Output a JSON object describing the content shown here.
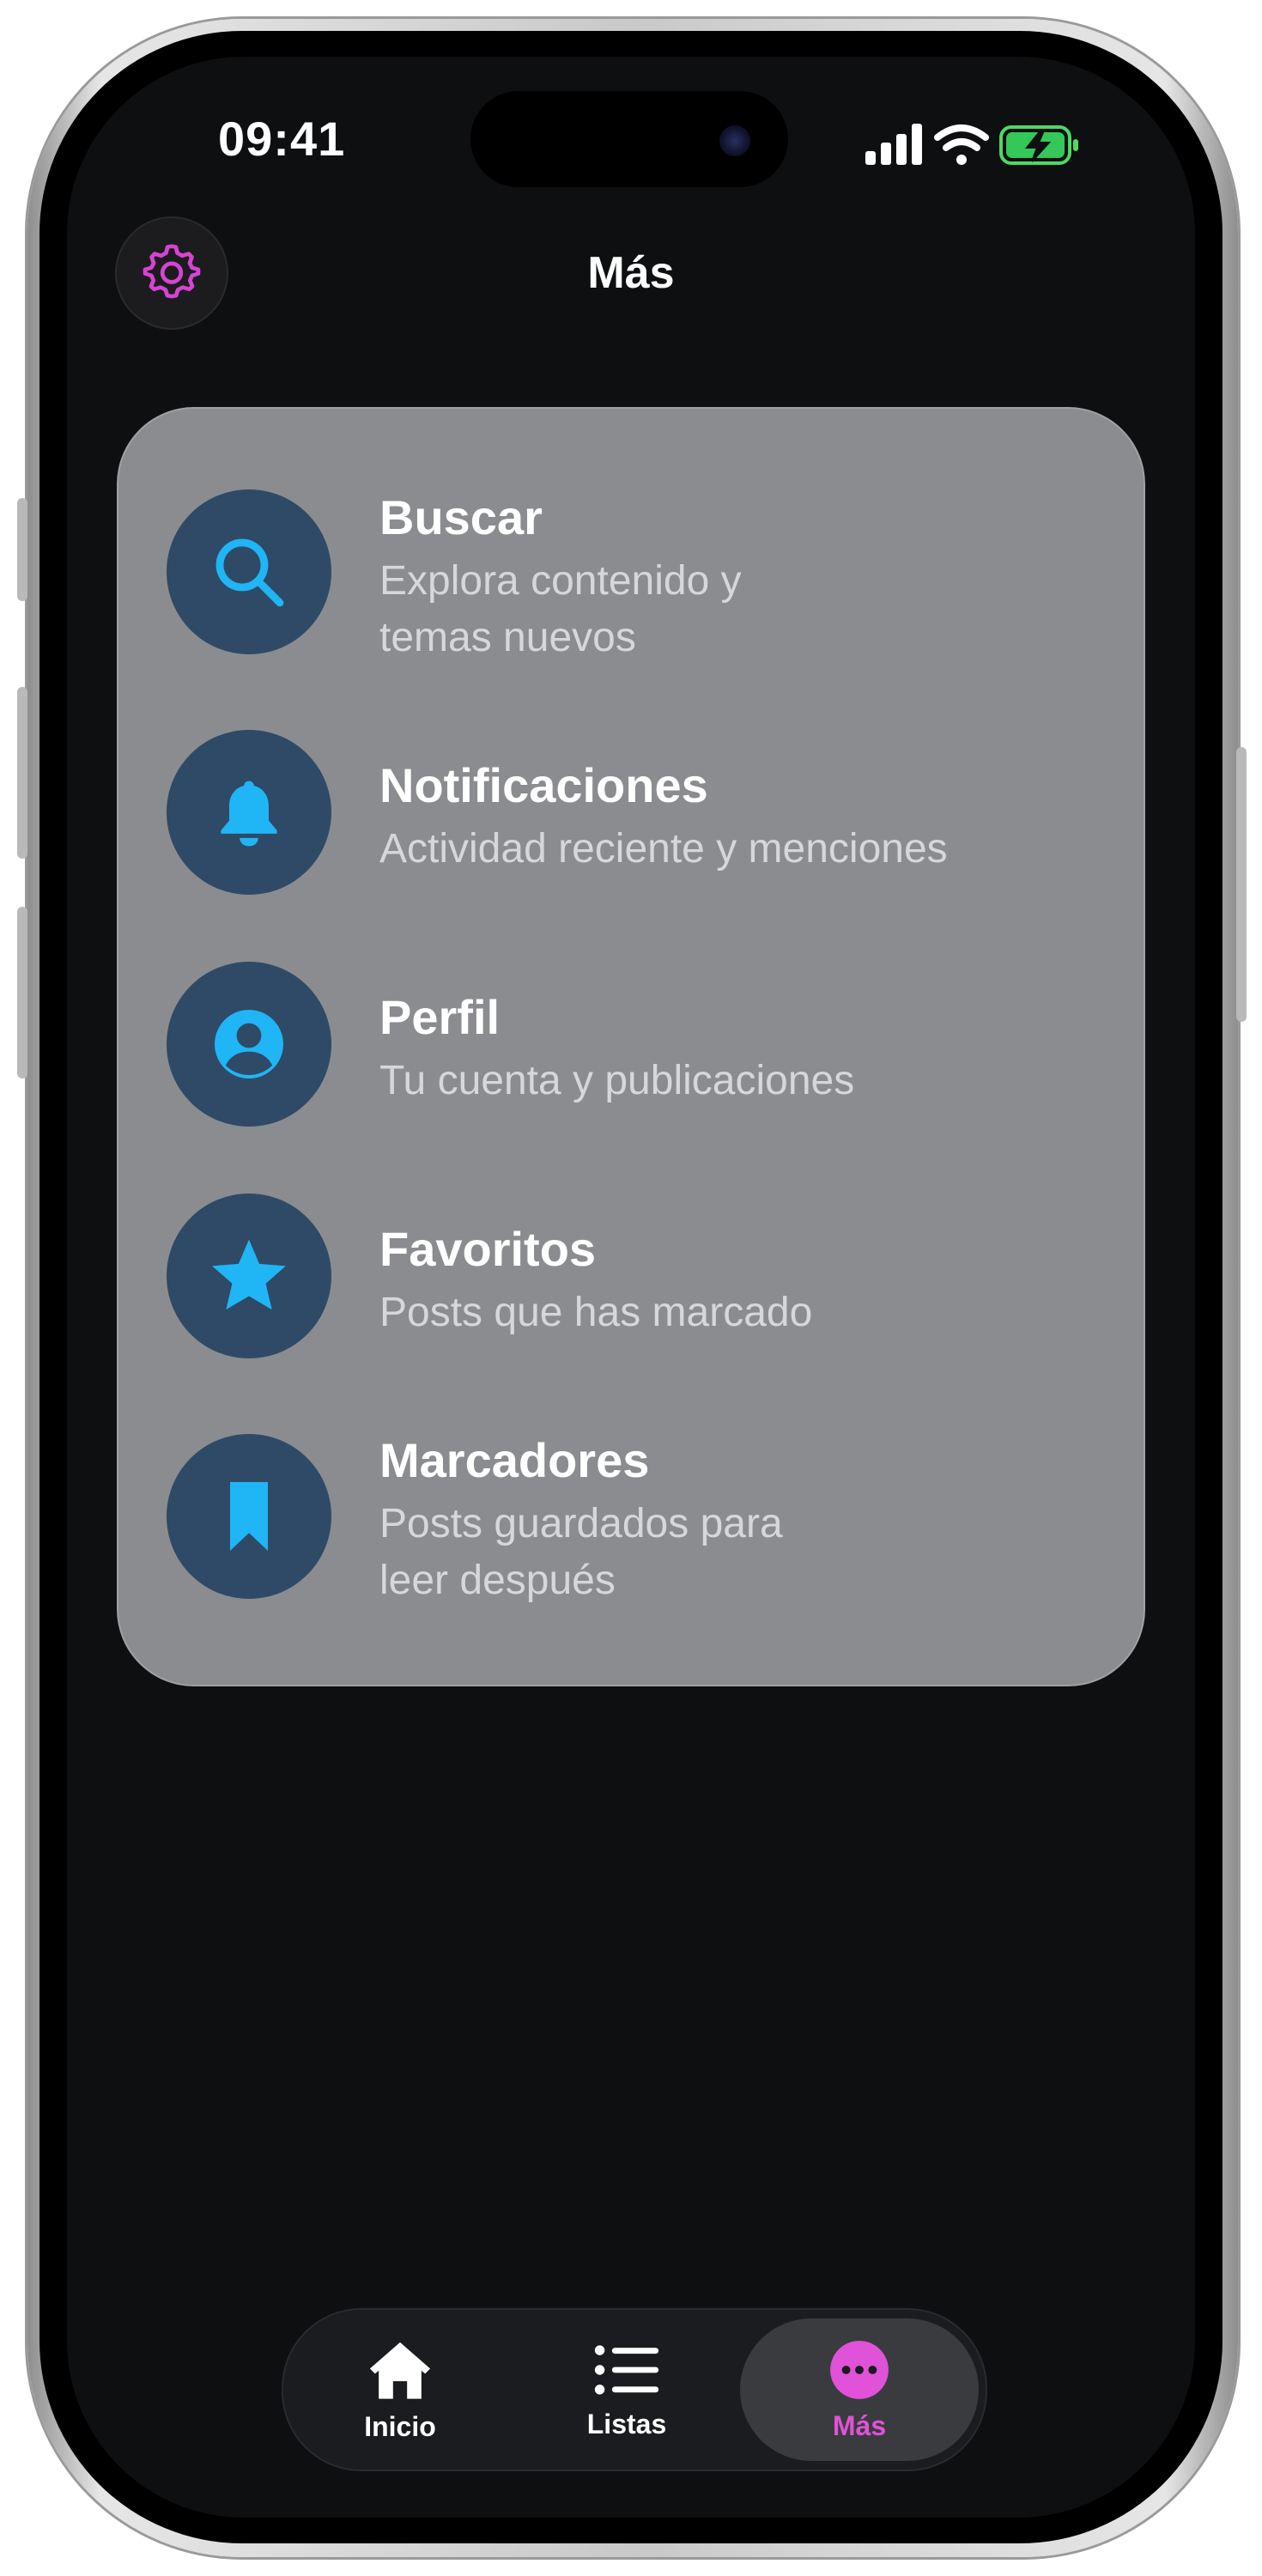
{
  "status_bar": {
    "time": "09:41"
  },
  "header": {
    "title": "Más",
    "settings_icon": "gear-icon"
  },
  "menu": {
    "items": [
      {
        "title": "Buscar",
        "subtitle": "Explora contenido y temas nuevos",
        "icon": "search-icon"
      },
      {
        "title": "Notificaciones",
        "subtitle": "Actividad reciente y menciones",
        "icon": "bell-icon"
      },
      {
        "title": "Perfil",
        "subtitle": "Tu cuenta y publicaciones",
        "icon": "person-circle-icon"
      },
      {
        "title": "Favoritos",
        "subtitle": "Posts que has marcado",
        "icon": "star-icon"
      },
      {
        "title": "Marcadores",
        "subtitle": "Posts guardados para leer después",
        "icon": "bookmark-icon"
      }
    ]
  },
  "tab_bar": {
    "tabs": [
      {
        "label": "Inicio",
        "icon": "home-icon",
        "active": false
      },
      {
        "label": "Listas",
        "icon": "list-icon",
        "active": false
      },
      {
        "label": "Más",
        "icon": "more-icon",
        "active": true
      }
    ]
  },
  "colors": {
    "accent": "#e052d8",
    "icon_blue": "#20b5f5",
    "icon_circle": "#2e4a66",
    "card": "#8b8c8f",
    "background": "#0e0f11"
  }
}
